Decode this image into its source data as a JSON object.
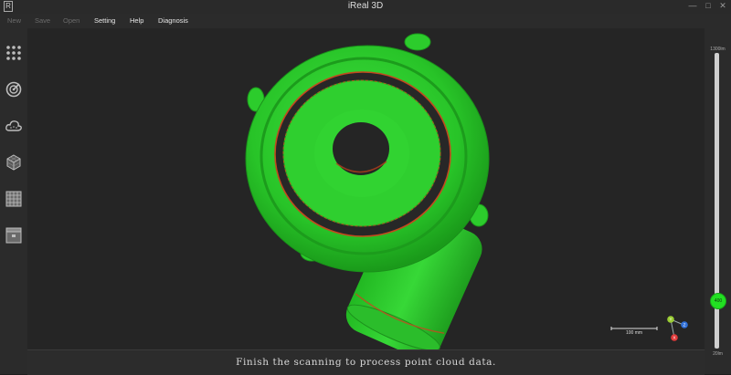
{
  "window": {
    "title": "iReal 3D",
    "logo_text": "R",
    "controls": {
      "minimize": "—",
      "maximize": "□",
      "close": "✕"
    }
  },
  "menu": [
    {
      "label": "New",
      "enabled": false
    },
    {
      "label": "Save",
      "enabled": false
    },
    {
      "label": "Open",
      "enabled": false
    },
    {
      "label": "Setting",
      "enabled": true
    },
    {
      "label": "Help",
      "enabled": true
    },
    {
      "label": "Diagnosis",
      "enabled": true
    }
  ],
  "sidebar": [
    {
      "name": "dots-grid-icon"
    },
    {
      "name": "scan-target-icon"
    },
    {
      "name": "cloud-icon"
    },
    {
      "name": "mesh-cube-icon"
    },
    {
      "name": "grid-icon"
    },
    {
      "name": "export-box-icon"
    }
  ],
  "viewport": {
    "scale_label": "100 mm",
    "axis": {
      "x": "X",
      "y": "Y",
      "z": "Z",
      "x_color": "#e03a3a",
      "y_color": "#9acd32",
      "z_color": "#2f6fd8"
    },
    "model_color": "#2ed02e"
  },
  "slider": {
    "top_label": "1300lm",
    "bottom_label": "20lm",
    "thumb_label": "400",
    "value_fraction": 0.84,
    "accent": "#22e022"
  },
  "status": {
    "message": "Finish the scanning to process point cloud data."
  }
}
